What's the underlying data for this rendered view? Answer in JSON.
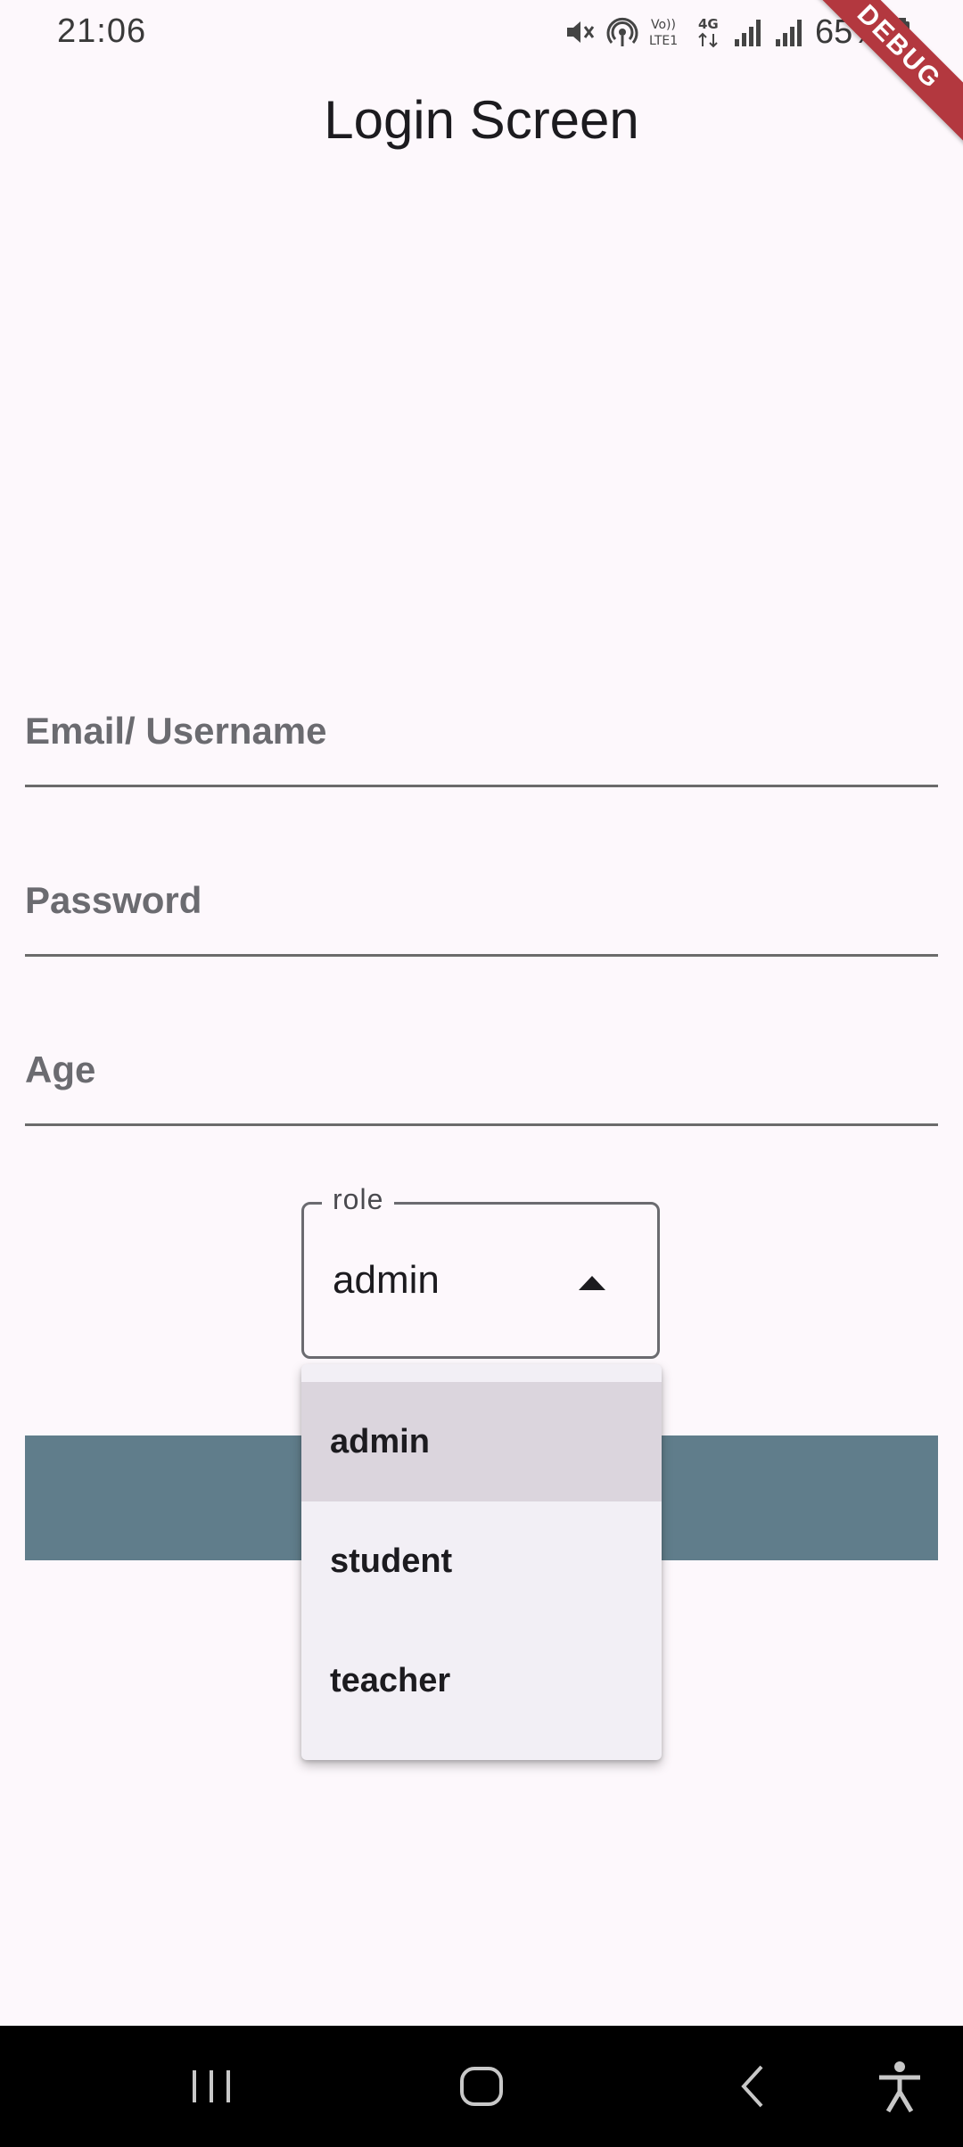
{
  "status_bar": {
    "time": "21:06",
    "battery": "65%",
    "network": "4G",
    "volte": "LTE1",
    "volte_top": "Vo))"
  },
  "debug_banner": "DEBUG",
  "app_bar": {
    "title": "Login Screen"
  },
  "form": {
    "email_label": "Email/ Username",
    "password_label": "Password",
    "age_label": "Age",
    "role": {
      "label": "role",
      "value": "admin",
      "options": [
        "admin",
        "student",
        "teacher"
      ],
      "selected_index": 0
    },
    "login_button_color": "#607d8b"
  },
  "nav_bar": {
    "items": [
      "recents-icon",
      "home-icon",
      "back-icon",
      "accessibility-icon"
    ]
  },
  "colors": {
    "background": "#fdf8fc",
    "menu_background": "#f2eff5",
    "menu_selected": "#dbd5dd",
    "debug_ribbon": "#b3383f"
  }
}
